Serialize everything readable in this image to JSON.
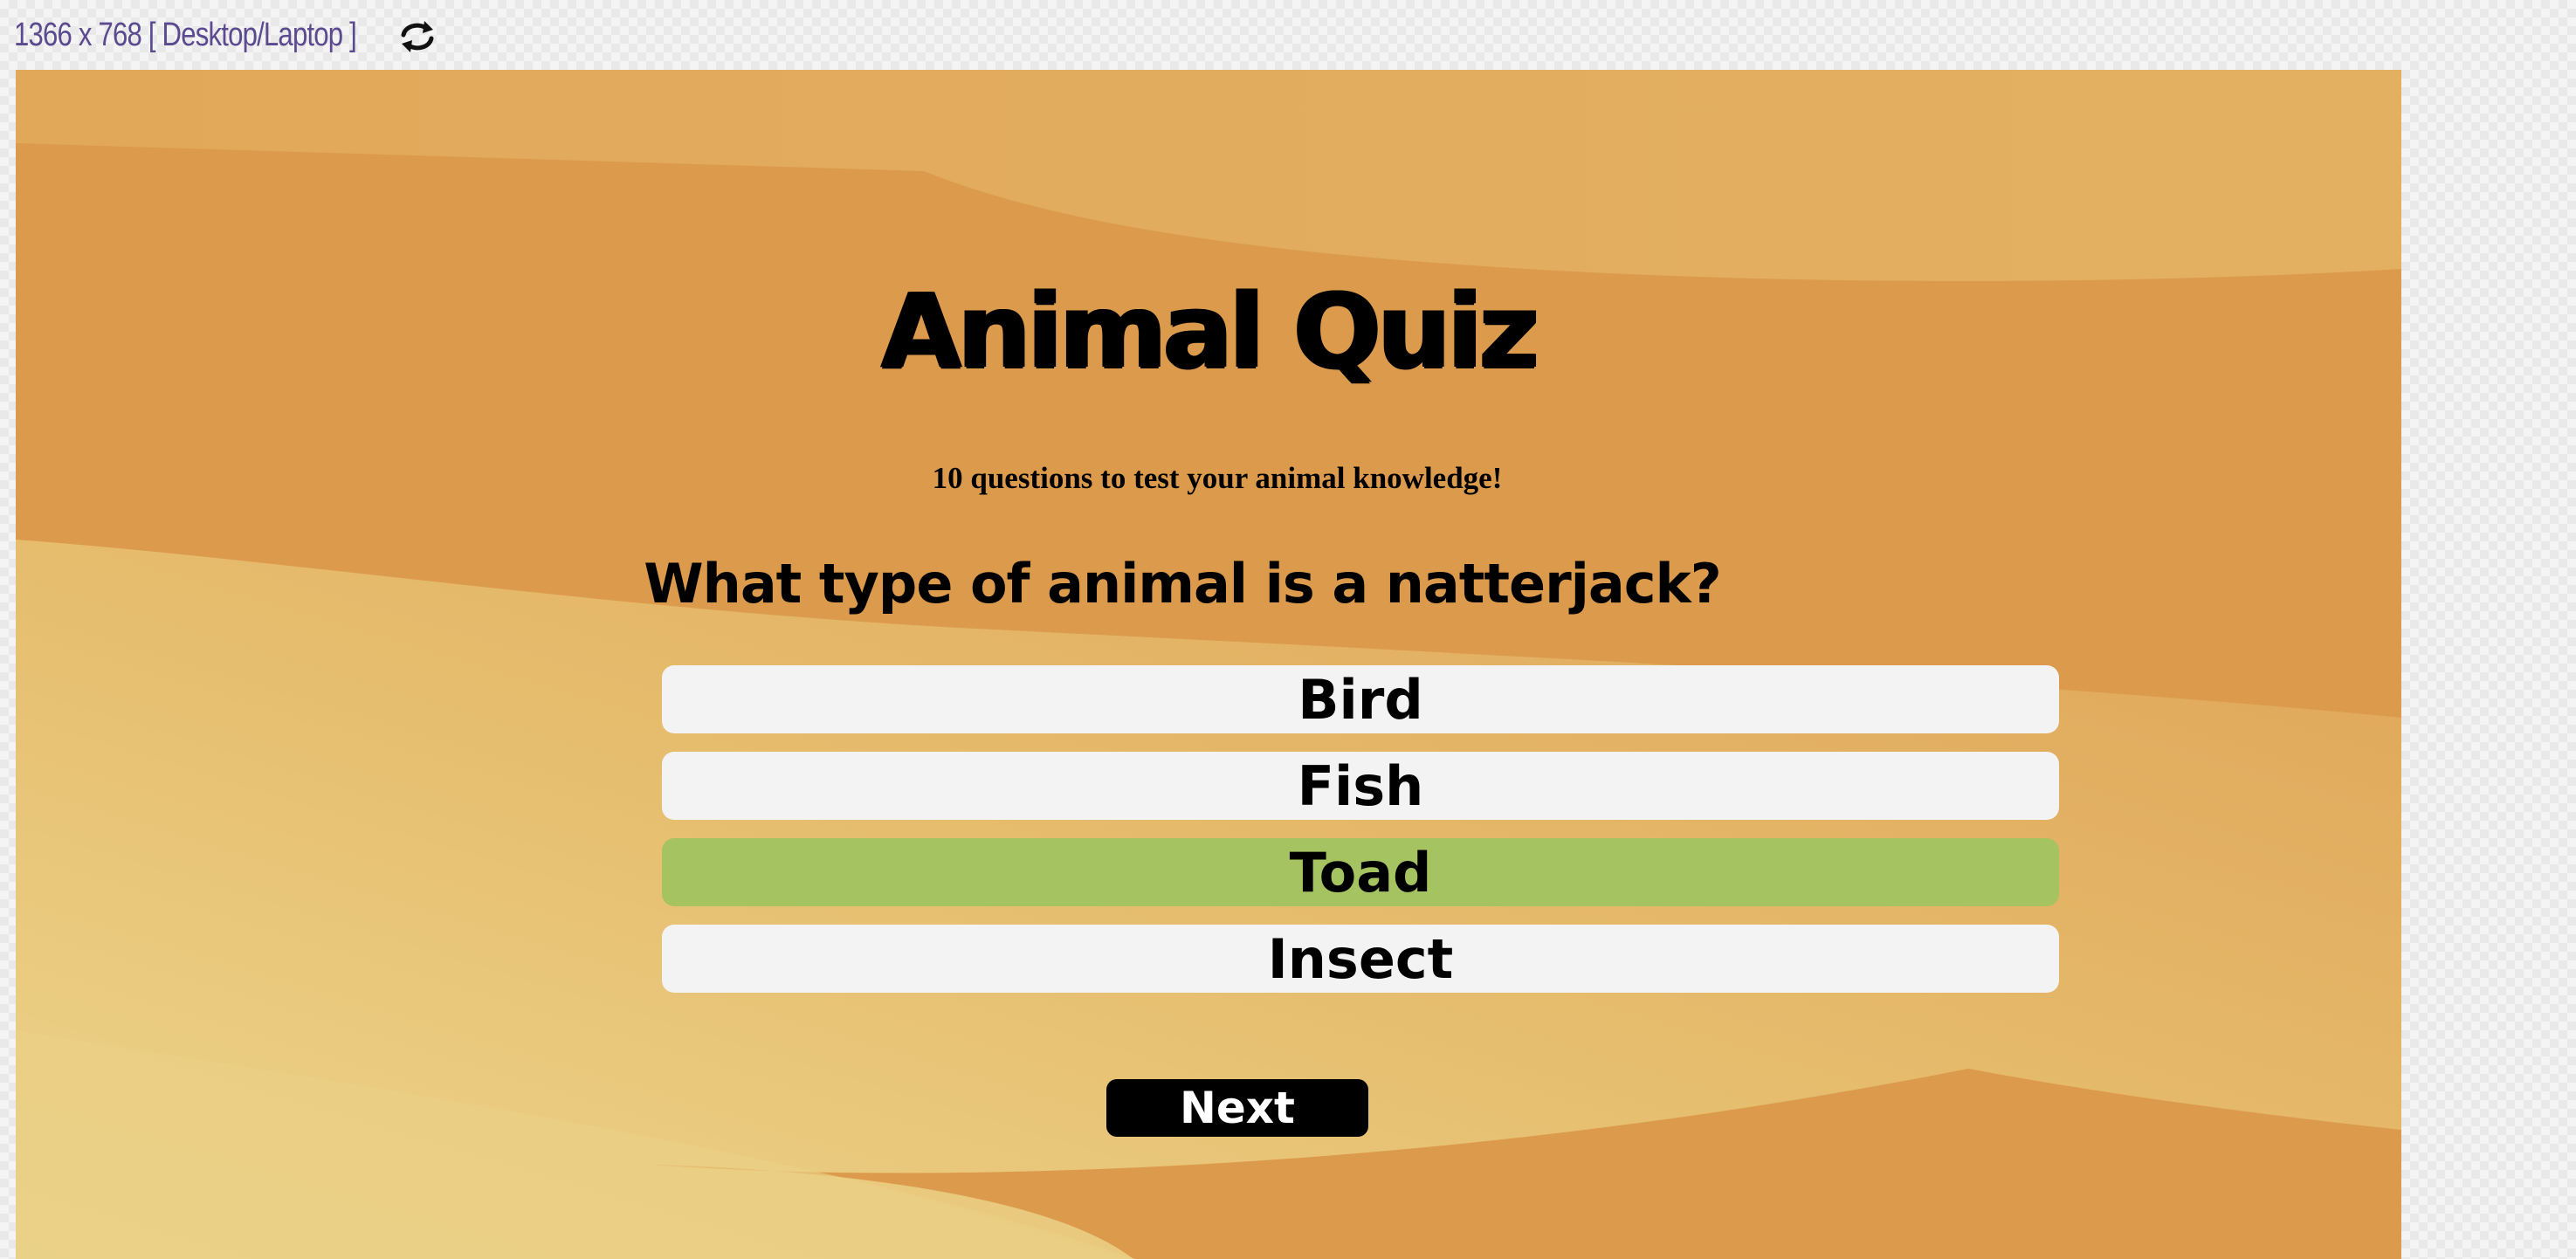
{
  "toolbar": {
    "resolution_label": "1366 x 768 [ Desktop/Laptop ]",
    "rotate_icon": "rotate-icon"
  },
  "quiz": {
    "title": "Animal Quiz",
    "subtitle": "10 questions to test your animal knowledge!",
    "question": "What type of animal is a natterjack?",
    "answers": [
      {
        "label": "Bird",
        "state": "default"
      },
      {
        "label": "Fish",
        "state": "default"
      },
      {
        "label": "Toad",
        "state": "correct"
      },
      {
        "label": "Insect",
        "state": "default"
      }
    ],
    "next_label": "Next"
  },
  "colors": {
    "background": "#dc9a4c",
    "dune_light": "#e8c67a",
    "answer_default": "#f3f3f3",
    "answer_correct": "#a6c361",
    "next_button": "#000000",
    "resolution_label": "#5b4a8f"
  }
}
